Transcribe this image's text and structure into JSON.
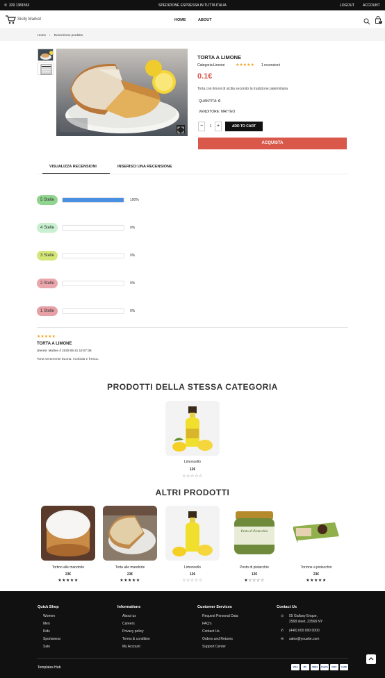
{
  "topbar": {
    "phone": "329 1381553",
    "promo": "SPEDIZIONE ESPRESSA IN TUTTA ITALIA",
    "logout": "LOGOUT",
    "account": "ACCOUNT",
    "phone_icon": "phone-icon"
  },
  "nav": {
    "brand": "Sicily Market",
    "home": "HOME",
    "about": "ABOUT",
    "cart_count": "0"
  },
  "breadcrumb": {
    "home": "Home",
    "sep": "›",
    "current": "Descrizione prodotto"
  },
  "product": {
    "title": "TORTA A LIMONE",
    "category_label": "Categoria:",
    "category": "Limone",
    "stars": "★★★★★",
    "reviews": "1 recensioni",
    "price": "0.1€",
    "description": "Torta con limoni di sicilia secondo la tradizione palermitana",
    "qty_label": "QUANTITÀ:",
    "qty_available": "0",
    "seller": "VENDITORE: MATTEO",
    "qty_value": "1",
    "minus": "−",
    "plus": "+",
    "add_to_cart": "ADD TO CART",
    "buy": "ACQUISTA"
  },
  "tabs": {
    "reviews": "VISUALIZZA RECENSIONI",
    "write": "INSERISCI UNA RECENSIONE"
  },
  "ratings": [
    {
      "label": "5 Stelle",
      "pct": "100%",
      "value": 1.0,
      "color": "#8fd48f"
    },
    {
      "label": "4 Stelle",
      "pct": "0%",
      "value": 0,
      "color": "#c9f0d0"
    },
    {
      "label": "3 Stelle",
      "pct": "0%",
      "value": 0,
      "color": "#d6e77a"
    },
    {
      "label": "2 Stelle",
      "pct": "0%",
      "value": 0,
      "color": "#e9a6ab"
    },
    {
      "label": "1 Stelle",
      "pct": "0%",
      "value": 0,
      "color": "#e7a0a5"
    }
  ],
  "review": {
    "stars": "★★★★★",
    "title": "TORTA A LIMONE",
    "meta": "Utente: Matteo // 2020-05-21 10:07:36",
    "text": "Torta veramente buona, morbida e fresca."
  },
  "same_category": {
    "heading": "PRODOTTI DELLA STESSA CATEGORIA",
    "items": [
      {
        "name": "Limoncello",
        "price": "12€",
        "stars": "☆☆☆☆☆"
      }
    ]
  },
  "other": {
    "heading": "ALTRI PRODOTTI",
    "items": [
      {
        "name": "Tortino alle mandorle",
        "price": "23€",
        "stars": "★★★★★"
      },
      {
        "name": "Torta alle mandorle",
        "price": "23€",
        "stars": "★★★★★"
      },
      {
        "name": "Limoncello",
        "price": "12€",
        "stars": "☆☆☆☆☆"
      },
      {
        "name": "Pesto di pistacchio",
        "price": "12€",
        "stars": "★☆☆☆☆"
      },
      {
        "name": "Torrone a pistacchio",
        "price": "23€",
        "stars": "★★★★★"
      }
    ],
    "jar_label": "Pesto di Pistacchio"
  },
  "footer": {
    "quick_shop": {
      "title": "Quick Shop",
      "items": [
        "Women",
        "Men",
        "Kids",
        "Sportswear",
        "Sale"
      ]
    },
    "informations": {
      "title": "Informations",
      "items": [
        "About us",
        "Careers",
        "Privacy policy",
        "Terms & condition",
        "My Account"
      ]
    },
    "customer": {
      "title": "Customer Services",
      "items": [
        "Request Personal Data",
        "FAQ's",
        "Contact Us",
        "Orders and Returns",
        "Support Center"
      ]
    },
    "contact": {
      "title": "Contact Us",
      "address": "55 Gallaxy Enque,",
      "address2": "2568 steet, 23568 NY",
      "phone": "(440) 000 000 0000",
      "email": "sales@yousite.com"
    },
    "brand": "Templates Hub",
    "payments": [
      "VISA",
      "MC",
      "AMEX",
      "PayPal",
      "DISC",
      "CARD"
    ]
  }
}
